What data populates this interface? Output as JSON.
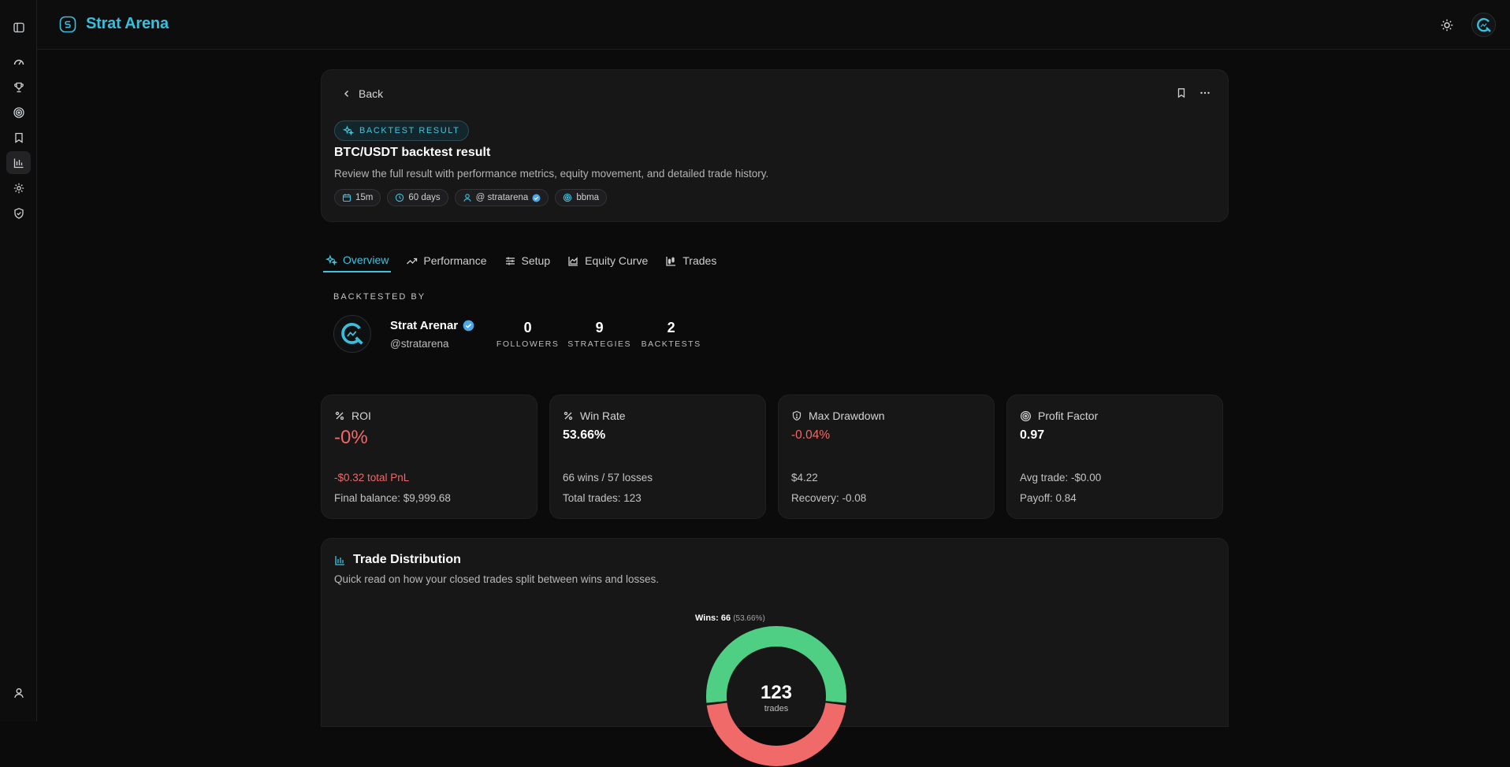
{
  "app": {
    "name": "Strat Arena"
  },
  "header": {
    "back_label": "Back",
    "badge_label": "BACKTEST RESULT",
    "title": "BTC/USDT backtest result",
    "description": "Review the full result with performance metrics, equity movement, and detailed trade history.",
    "chips": [
      "15m",
      "60 days",
      "@ stratarena",
      "bbma"
    ]
  },
  "tabs": [
    "Overview",
    "Performance",
    "Setup",
    "Equity Curve",
    "Trades"
  ],
  "backtested_by": {
    "label": "BACKTESTED BY",
    "name": "Strat Arenar",
    "handle": "@stratarena",
    "stats": [
      {
        "value": "0",
        "label": "FOLLOWERS"
      },
      {
        "value": "9",
        "label": "STRATEGIES"
      },
      {
        "value": "2",
        "label": "BACKTESTS"
      }
    ]
  },
  "metrics": [
    {
      "label": "ROI",
      "value": "-0%",
      "line1": "-$0.32 total PnL",
      "line2": "Final balance: $9,999.68"
    },
    {
      "label": "Win Rate",
      "value": "53.66%",
      "line1": "66 wins / 57 losses",
      "line2": "Total trades: 123"
    },
    {
      "label": "Max Drawdown",
      "value": "-0.04%",
      "line1": "$4.22",
      "line2": "Recovery: -0.08"
    },
    {
      "label": "Profit Factor",
      "value": "0.97",
      "line1": "Avg trade: -$0.00",
      "line2": "Payoff: 0.84"
    }
  ],
  "distribution": {
    "title": "Trade Distribution",
    "description": "Quick read on how your closed trades split between wins and losses.",
    "wins_label": "Wins: 66",
    "wins_pct": "(53.66%)",
    "total": "123",
    "total_unit": "trades",
    "wins": 66,
    "losses": 57
  },
  "colors": {
    "accent": "#3ec3df",
    "negative": "#f26767",
    "win": "#4fcf84",
    "loss": "#f06a6a"
  }
}
